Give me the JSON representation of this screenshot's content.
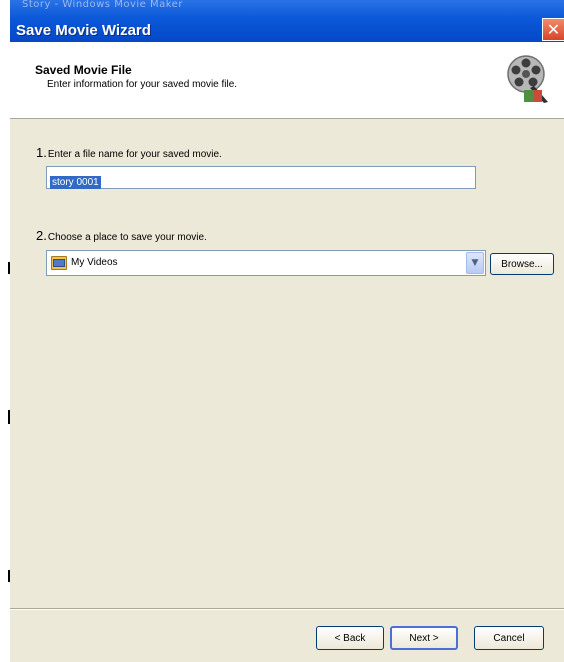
{
  "window": {
    "behind_title": "Story - Windows Movie Maker",
    "title": "Save Movie Wizard",
    "close_glyph": "✕"
  },
  "header": {
    "title": "Saved Movie File",
    "subtitle": "Enter information for your saved movie file.",
    "icon": "film-reel-icon"
  },
  "step1": {
    "number": "1.",
    "label": "Enter a file name for your saved movie.",
    "filename_value": "story 0001"
  },
  "step2": {
    "number": "2.",
    "label": "Choose a place to save your movie.",
    "folder_value": "My Videos",
    "browse_label": "Browse..."
  },
  "footer": {
    "back_label": "< Back",
    "next_label": "Next >",
    "cancel_label": "Cancel"
  },
  "colors": {
    "titlebar": "#0a58d8",
    "dialog_bg": "#ece9d8",
    "selection": "#316ac5"
  }
}
